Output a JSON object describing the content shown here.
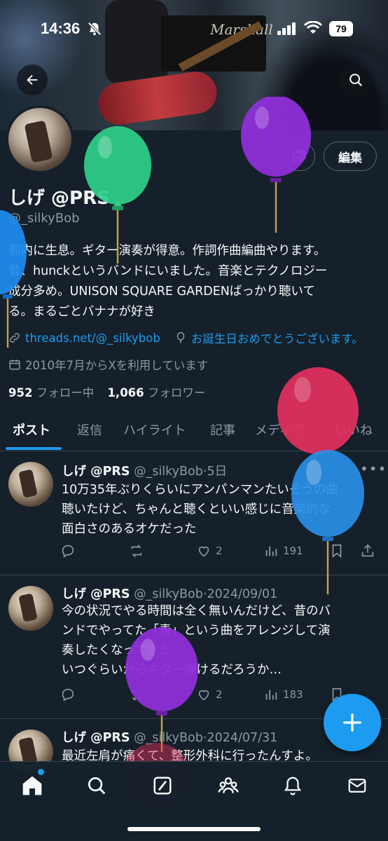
{
  "status_bar": {
    "time": "14:36",
    "battery": "79"
  },
  "banner": {
    "amp_logo": "Marshall"
  },
  "profile": {
    "name": "しげ @PRS",
    "handle": "@_silkyBob",
    "edit_label": "編集",
    "bio_lines": [
      "都内に生息。ギター演奏が得意。作詞作曲編曲やります。",
      "昔、hunckというバンドにいました。音楽とテクノロジー",
      "成分多め。UNISON SQUARE GARDENばっかり聴いて",
      "る。まるごとバナナが好き"
    ],
    "link": "threads.net/@_silkybob",
    "birthday": "お誕生日おめでとうございます。",
    "joined": "2010年7月からXを利用しています",
    "following_count": "952",
    "following_label": "フォロー中",
    "followers_count": "1,066",
    "followers_label": "フォロワー"
  },
  "tabs": [
    "ポスト",
    "返信",
    "ハイライト",
    "記事",
    "メディア",
    "いいね"
  ],
  "posts": [
    {
      "name": "しげ @PRS",
      "handle": "@_silkyBob",
      "date": "5日",
      "lines": [
        "10万35年ぶりくらいにアンパンマンたいそうの曲",
        "聴いたけど、ちゃんと聴くといい感じに音楽的な",
        "面白さのあるオケだった"
      ],
      "likes": "2",
      "views": "191"
    },
    {
      "name": "しげ @PRS",
      "handle": "@_silkyBob",
      "date": "2024/09/01",
      "lines": [
        "今の状況でやる時間は全く無いんだけど、昔のバ",
        "ンドでやってた「青」という曲をアレンジして演",
        "奏したくなってきた",
        "いつぐらいからギター弾けるだろうか…"
      ],
      "likes": "2",
      "views": "183"
    },
    {
      "name": "しげ @PRS",
      "handle": "@_silkyBob",
      "date": "2024/07/31",
      "lines": [
        "最近左肩が痛くて、整形外科に行ったんすよ。"
      ]
    }
  ],
  "colors": {
    "accent": "#1d9bf0",
    "background": "#15202b",
    "muted": "#8b98a5"
  }
}
